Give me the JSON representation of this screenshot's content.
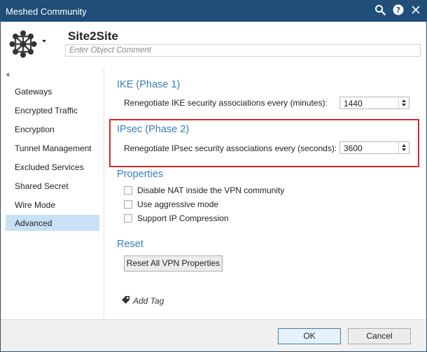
{
  "window": {
    "title": "Meshed Community"
  },
  "titlebar_icons": [
    "search-icon",
    "help-icon",
    "close-icon"
  ],
  "object": {
    "name": "Site2Site",
    "comment_placeholder": "Enter Object Comment"
  },
  "sidebar": {
    "collapse_glyph": "‹‹",
    "items": [
      {
        "label": "Gateways"
      },
      {
        "label": "Encrypted Traffic"
      },
      {
        "label": "Encryption"
      },
      {
        "label": "Tunnel Management"
      },
      {
        "label": "Excluded Services"
      },
      {
        "label": "Shared Secret"
      },
      {
        "label": "Wire Mode"
      },
      {
        "label": "Advanced"
      }
    ],
    "selected": "Advanced"
  },
  "ike": {
    "title": "IKE (Phase 1)",
    "label": "Renegotiate IKE security associations every (minutes):",
    "value": "1440"
  },
  "ipsec": {
    "title": "IPsec (Phase 2)",
    "label": "Renegotiate IPsec security associations every (seconds):",
    "value": "3600"
  },
  "properties": {
    "title": "Properties",
    "options": [
      {
        "label": "Disable NAT inside the VPN community",
        "checked": false
      },
      {
        "label": "Use aggressive mode",
        "checked": false
      },
      {
        "label": "Support IP Compression",
        "checked": false
      }
    ]
  },
  "reset": {
    "title": "Reset",
    "button_label": "Reset All VPN Properties"
  },
  "tag": {
    "label": "Add Tag"
  },
  "footer": {
    "ok_label": "OK",
    "cancel_label": "Cancel"
  },
  "colors": {
    "titlebar": "#1f4e79",
    "accent": "#3a7dbf",
    "selection": "#c8e1f6",
    "highlight": "#d42a2a"
  }
}
